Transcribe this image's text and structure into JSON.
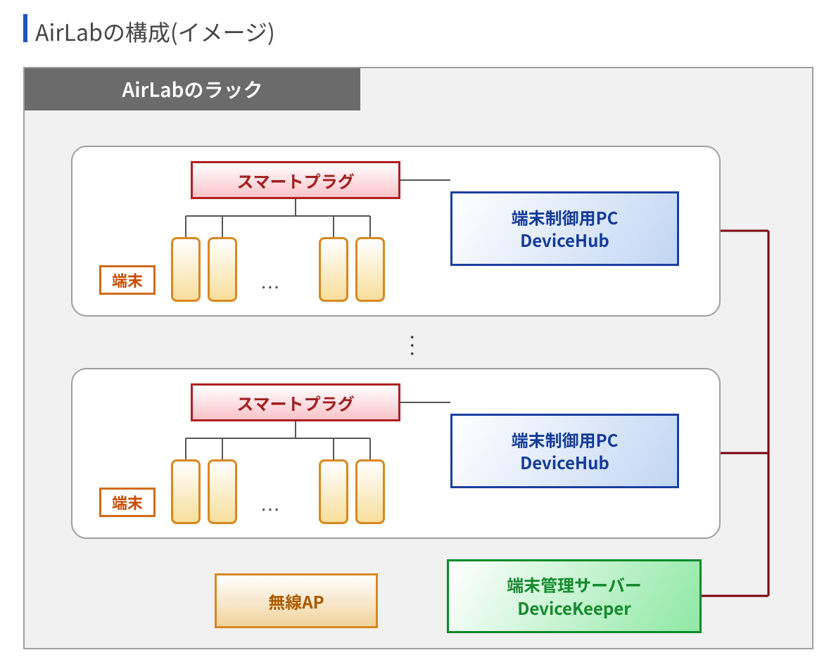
{
  "title": "AirLabの構成(イメージ)",
  "tab": "AirLabのラック",
  "block": {
    "smartplug": "スマートプラグ",
    "terminal_label": "端末",
    "dots": "...",
    "devicehub_line1": "端末制御用PC",
    "devicehub_line2": "DeviceHub"
  },
  "vdots": "...",
  "wireless_ap": "無線AP",
  "devicekeeper_line1": "端末管理サーバー",
  "devicekeeper_line2": "DeviceKeeper"
}
